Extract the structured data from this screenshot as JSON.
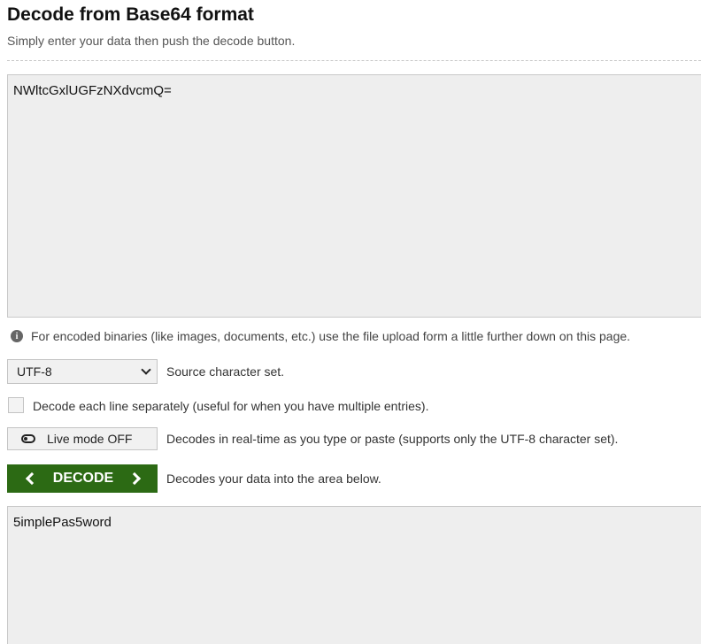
{
  "header": {
    "title": "Decode from Base64 format",
    "subtitle": "Simply enter your data then push the decode button."
  },
  "input": {
    "value": "NWltcGxlUGFzNXdvcmQ="
  },
  "info": {
    "icon": "info-icon",
    "text": "For encoded binaries (like images, documents, etc.) use the file upload form a little further down on this page."
  },
  "charset": {
    "selected": "UTF-8",
    "label": "Source character set."
  },
  "line_option": {
    "checked": false,
    "label": "Decode each line separately (useful for when you have multiple entries)."
  },
  "live_mode": {
    "button_label": "Live mode OFF",
    "description": "Decodes in real-time as you type or paste (supports only the UTF-8 character set)."
  },
  "decode": {
    "button_label": "DECODE",
    "description": "Decodes your data into the area below."
  },
  "output": {
    "value": "5implePas5word"
  },
  "colors": {
    "decode_button": "#2c6a14",
    "textarea_bg": "#eeeeee"
  }
}
